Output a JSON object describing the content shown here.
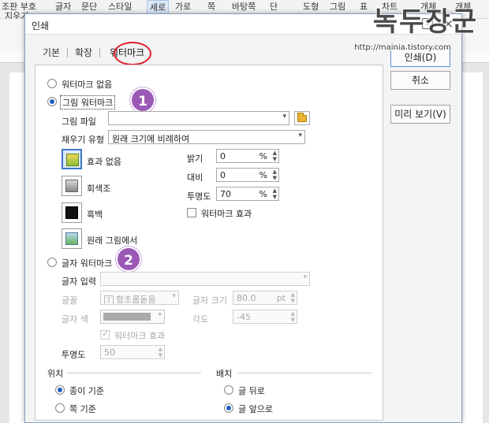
{
  "app_menu": {
    "row1": [
      "조판 부호",
      "글자",
      "문단",
      "스타일",
      "세로",
      "가로",
      "쪽",
      "바탕쪽",
      "단",
      "도형",
      "그림",
      "표",
      "차트",
      "개체",
      "개체"
    ],
    "row2_first": "지우기"
  },
  "dialog": {
    "title": "인쇄",
    "help_label": "?",
    "close_label": "×",
    "tabs": [
      "기본",
      "확장",
      "워터마크"
    ],
    "no_watermark_label": "워터마크 없음",
    "picture_watermark": {
      "label": "그림 워터마크",
      "file_label": "그림 파일",
      "file_value": "",
      "fill_label": "채우기 유형",
      "fill_value": "원래 크기에 비례하여",
      "effects": [
        "효과 없음",
        "회색조",
        "흑백",
        "원래 그림에서"
      ],
      "brightness_label": "밝기",
      "brightness_value": "0",
      "contrast_label": "대비",
      "contrast_value": "0",
      "transparency_label": "투명도",
      "transparency_value": "70",
      "percent_unit": "%",
      "wm_effect_label": "워터마크 효과"
    },
    "text_watermark": {
      "label": "글자 워터마크",
      "text_input_label": "글자 입력",
      "text_input_value": "",
      "font_label": "글꼴",
      "font_value": "함초롬돋움",
      "font_icon_glyph": "T",
      "size_label": "글자 크기",
      "size_value": "80.0",
      "size_unit": "pt",
      "color_label": "글자 색",
      "angle_label": "각도",
      "angle_value": "-45",
      "wm_effect_label": "워터마크 효과",
      "transparency_label": "투명도",
      "transparency_value": "50"
    },
    "position": {
      "title": "위치",
      "options": [
        "종이 기준",
        "쪽 기준"
      ]
    },
    "arrangement": {
      "title": "배치",
      "options": [
        "글 뒤로",
        "글 앞으로"
      ]
    },
    "buttons": {
      "print": "인쇄(D)",
      "cancel": "취소",
      "preview": "미리 보기(V)"
    }
  },
  "annotations": {
    "badge1": "1",
    "badge2": "2",
    "badge_color": "#9b59b6",
    "tab_circle_color": "#e0202a"
  },
  "watermark_overlay": {
    "title": "녹두장군",
    "url": "http://mainia.tistory.com"
  }
}
